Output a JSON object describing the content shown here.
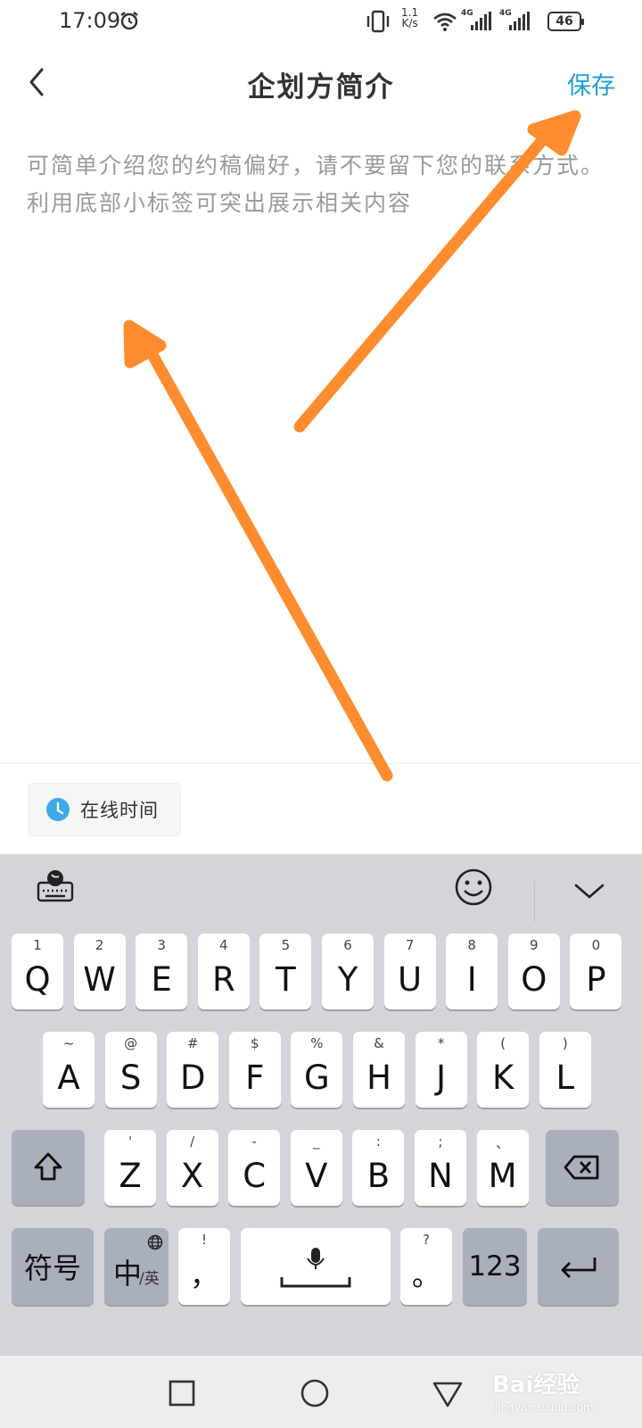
{
  "status_bar": {
    "time": "17:09",
    "net_speed_value": "1.1",
    "net_speed_unit": "K/s",
    "sig1": "4G",
    "sig2": "4G",
    "battery": "46"
  },
  "header": {
    "title": "企划方简介",
    "save_label": "保存"
  },
  "editor": {
    "placeholder": "可简单介绍您的约稿偏好，请不要留下您的联系方式。利用底部小标签可突出展示相关内容"
  },
  "tag": {
    "label": "在线时间"
  },
  "keyboard": {
    "row1": [
      {
        "hint": "1",
        "key": "Q"
      },
      {
        "hint": "2",
        "key": "W"
      },
      {
        "hint": "3",
        "key": "E"
      },
      {
        "hint": "4",
        "key": "R"
      },
      {
        "hint": "5",
        "key": "T"
      },
      {
        "hint": "6",
        "key": "Y"
      },
      {
        "hint": "7",
        "key": "U"
      },
      {
        "hint": "8",
        "key": "I"
      },
      {
        "hint": "9",
        "key": "O"
      },
      {
        "hint": "0",
        "key": "P"
      }
    ],
    "row2": [
      {
        "hint": "~",
        "key": "A"
      },
      {
        "hint": "@",
        "key": "S"
      },
      {
        "hint": "#",
        "key": "D"
      },
      {
        "hint": "$",
        "key": "F"
      },
      {
        "hint": "%",
        "key": "G"
      },
      {
        "hint": "&",
        "key": "H"
      },
      {
        "hint": "*",
        "key": "J"
      },
      {
        "hint": "(",
        "key": "K"
      },
      {
        "hint": ")",
        "key": "L"
      }
    ],
    "row3": [
      {
        "hint": "'",
        "key": "Z"
      },
      {
        "hint": "/",
        "key": "X"
      },
      {
        "hint": "-",
        "key": "C"
      },
      {
        "hint": "_",
        "key": "V"
      },
      {
        "hint": ":",
        "key": "B"
      },
      {
        "hint": ";",
        "key": "N"
      },
      {
        "hint": "、",
        "key": "M"
      }
    ],
    "symbols_label": "符号",
    "lang_main": "中",
    "lang_sub": "/英",
    "comma_hint": "!",
    "comma_key": "，",
    "period_hint": "?",
    "period_key": "。",
    "numbers_label": "123"
  },
  "watermark": {
    "text": "Bai经验",
    "sub": "jingyan.baidu.com"
  },
  "colors": {
    "accent": "#1d9fd6",
    "annotation_arrow": "#ff8c2e",
    "keyboard_bg": "#d3d5db"
  }
}
